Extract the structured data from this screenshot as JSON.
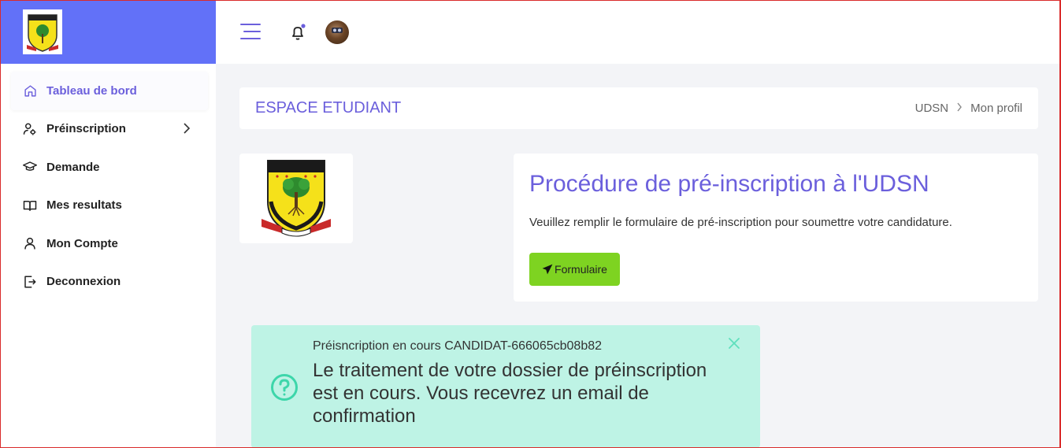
{
  "sidebar": {
    "items": [
      {
        "label": "Tableau de bord",
        "icon": "home-icon"
      },
      {
        "label": "Préinscription",
        "icon": "user-settings-icon"
      },
      {
        "label": "Demande",
        "icon": "graduation-cap-icon"
      },
      {
        "label": "Mes resultats",
        "icon": "book-icon"
      },
      {
        "label": "Mon Compte",
        "icon": "user-icon"
      },
      {
        "label": "Deconnexion",
        "icon": "logout-icon"
      }
    ]
  },
  "header": {
    "title": "ESPACE ETUDIANT",
    "breadcrumb": [
      "UDSN",
      "Mon profil"
    ]
  },
  "procedure": {
    "title": "Procédure de pré-inscription à l'UDSN",
    "text": "Veuillez remplir le formulaire de pré-inscription pour soumettre votre candidature.",
    "button_label": "Formulaire"
  },
  "alert": {
    "title": "Préisncription en cours CANDIDAT-666065cb08b82",
    "message": "Le traitement de votre dossier de préinscription est en cours. Vous recevrez un email de confirmation"
  },
  "colors": {
    "brand": "#6271f8",
    "accent": "#6b5fdc",
    "button": "#7ed321",
    "alert_bg": "#bef3e5",
    "alert_icon": "#3dd6aa"
  }
}
